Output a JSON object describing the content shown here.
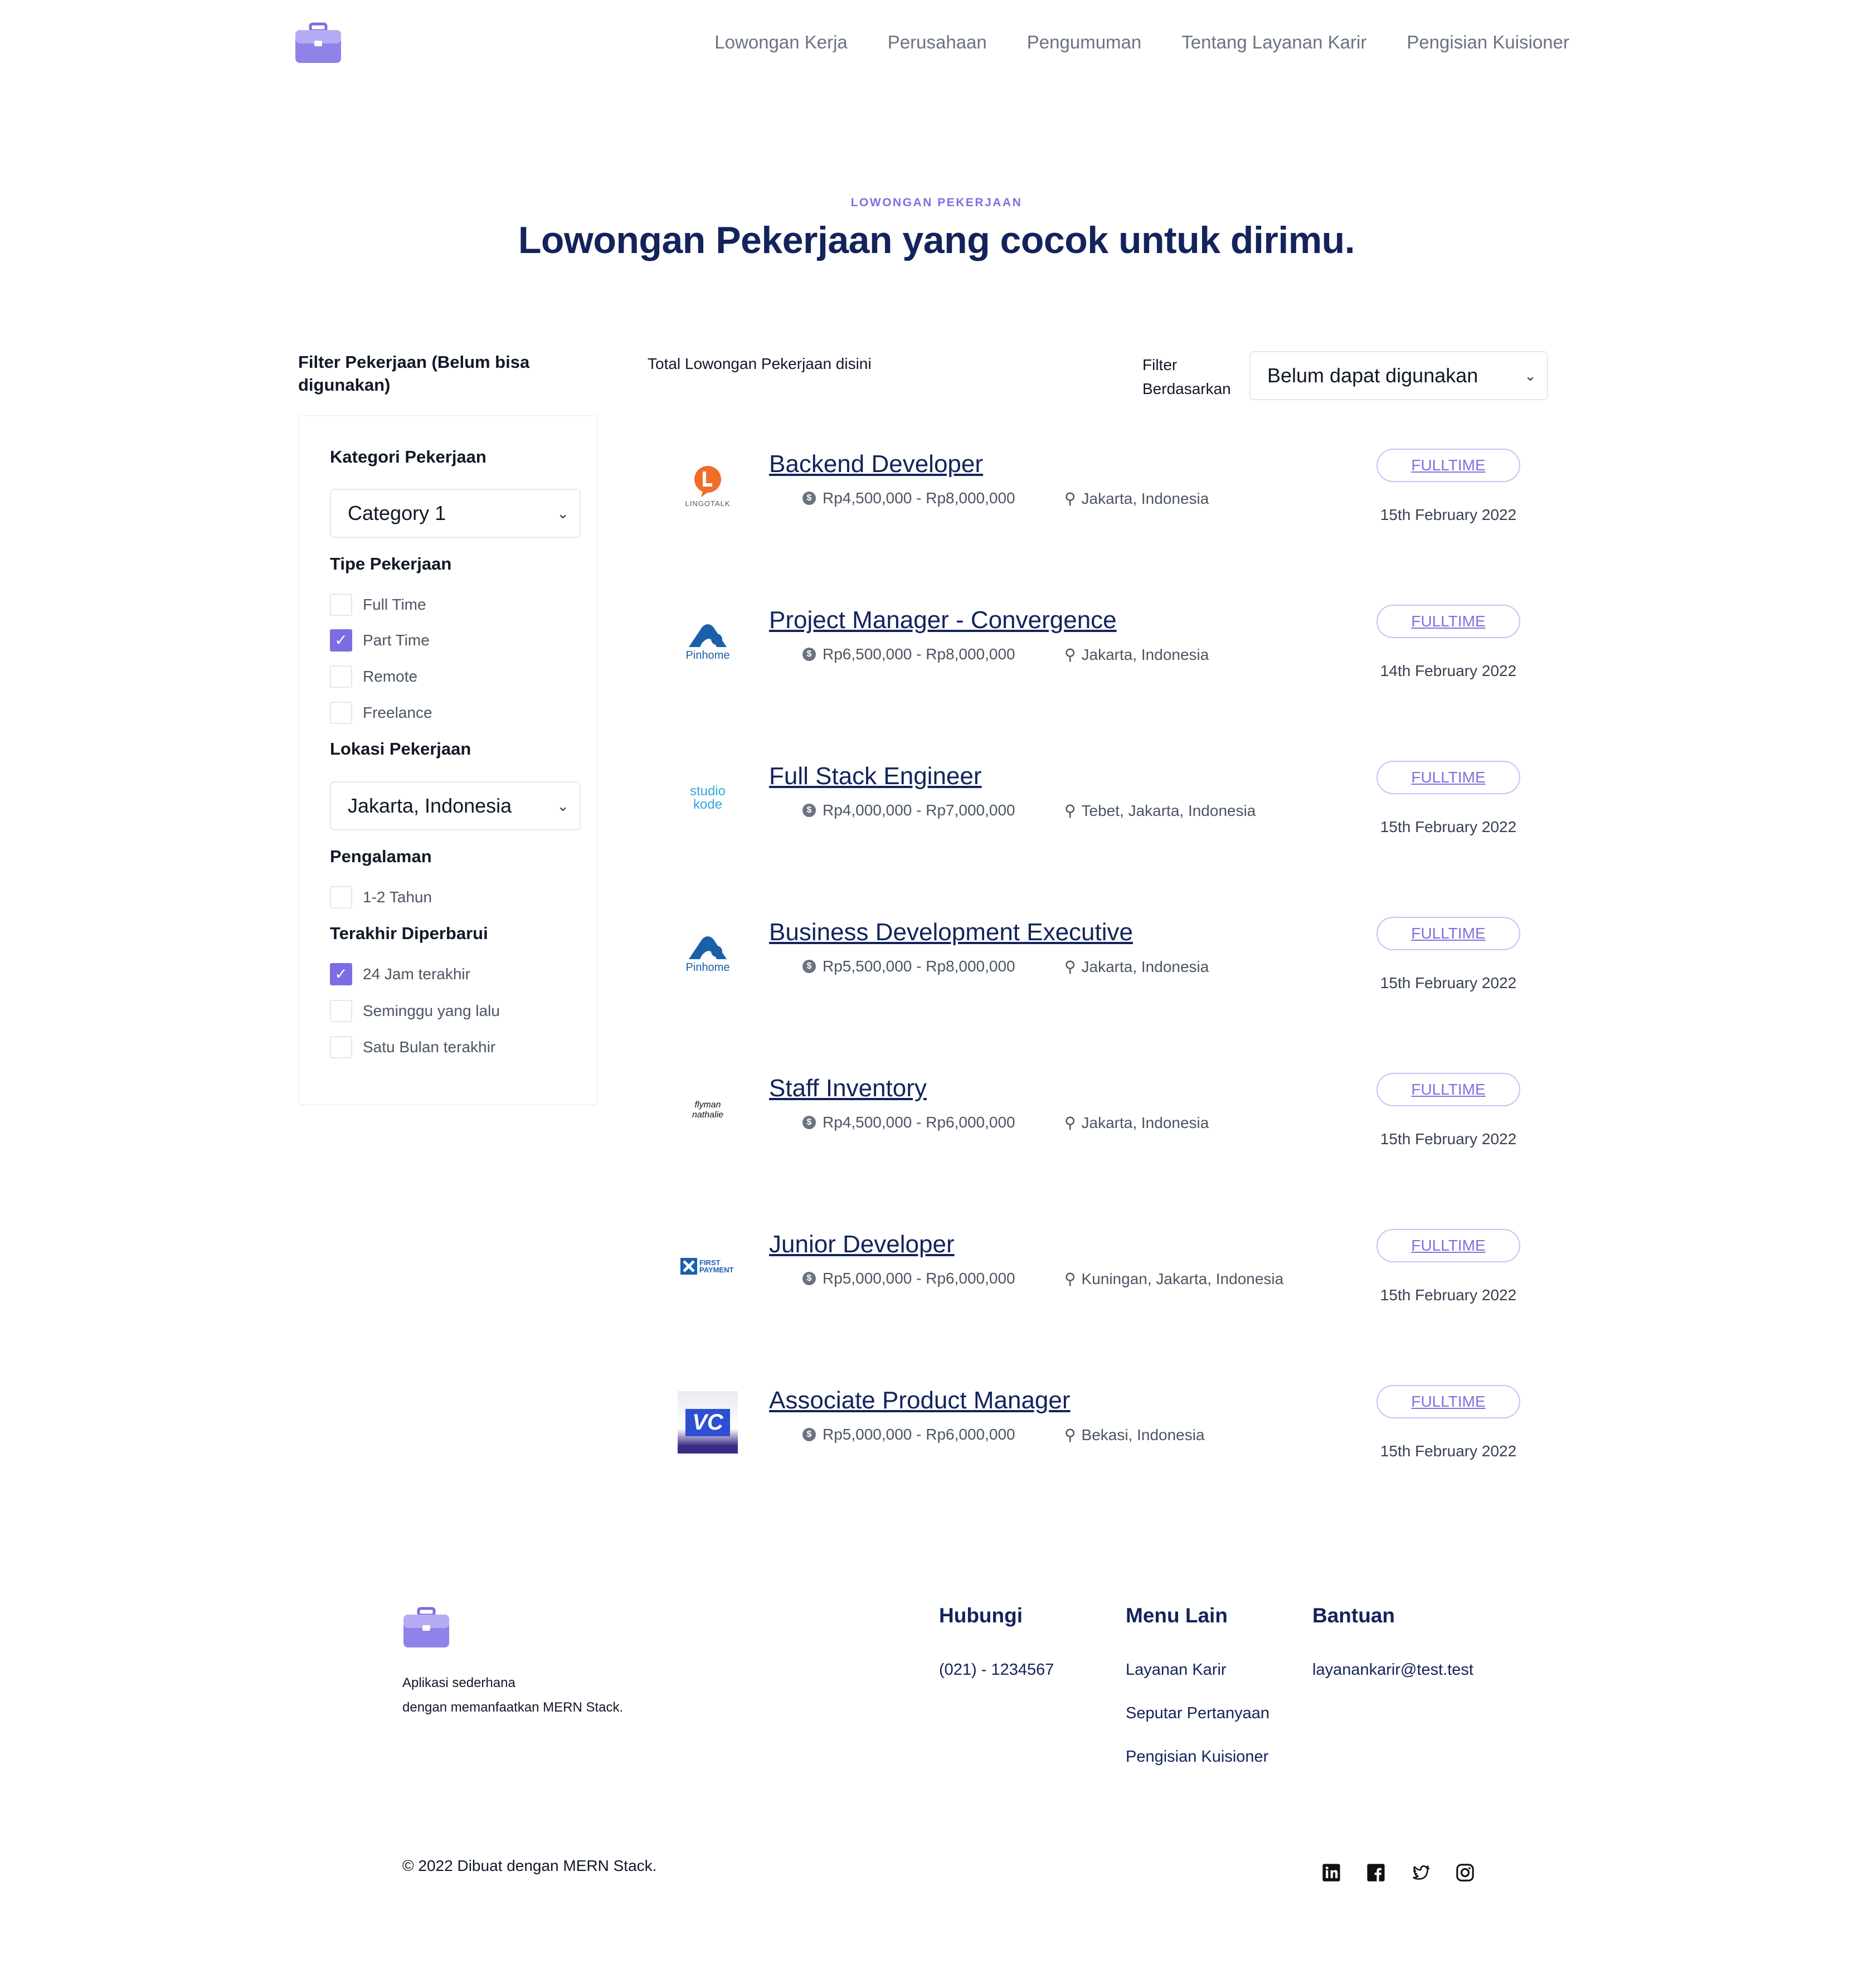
{
  "nav": {
    "items": [
      "Lowongan Kerja",
      "Perusahaan",
      "Pengumuman",
      "Tentang Layanan Karir",
      "Pengisian Kuisioner"
    ]
  },
  "hero": {
    "eyebrow": "LOWONGAN PEKERJAAN",
    "title": "Lowongan Pekerjaan yang cocok untuk dirimu."
  },
  "sidebar": {
    "title": "Filter Pekerjaan (Belum bisa digunakan)",
    "category": {
      "label": "Kategori Pekerjaan",
      "selected": "Category 1"
    },
    "job_type": {
      "label": "Tipe Pekerjaan",
      "options": [
        {
          "label": "Full Time",
          "checked": false
        },
        {
          "label": "Part Time",
          "checked": true
        },
        {
          "label": "Remote",
          "checked": false
        },
        {
          "label": "Freelance",
          "checked": false
        }
      ]
    },
    "location": {
      "label": "Lokasi Pekerjaan",
      "selected": "Jakarta, Indonesia"
    },
    "experience": {
      "label": "Pengalaman",
      "options": [
        {
          "label": "1-2 Tahun",
          "checked": false
        }
      ]
    },
    "updated": {
      "label": "Terakhir Diperbarui",
      "options": [
        {
          "label": "24 Jam terakhir",
          "checked": true
        },
        {
          "label": "Seminggu yang lalu",
          "checked": false
        },
        {
          "label": "Satu Bulan terakhir",
          "checked": false
        }
      ]
    }
  },
  "list": {
    "total_label": "Total Lowongan Pekerjaan disini",
    "filter_label": "Filter Berdasarkan",
    "filter_line1": "Filter",
    "filter_line2": "Berdasarkan",
    "sort_selected": "Belum dapat digunakan"
  },
  "jobs": [
    {
      "title": "Backend Developer",
      "salary": "Rp4,500,000 - Rp8,000,000",
      "location": "Jakarta, Indonesia",
      "type": "FULLTIME",
      "date": "15th February 2022",
      "logo_text": "LINGOTALK"
    },
    {
      "title": "Project Manager - Convergence",
      "salary": "Rp6,500,000 - Rp8,000,000",
      "location": "Jakarta, Indonesia",
      "type": "FULLTIME",
      "date": "14th February 2022",
      "logo_text": "Pinhome"
    },
    {
      "title": "Full Stack Engineer",
      "salary": "Rp4,000,000 - Rp7,000,000",
      "location": "Tebet, Jakarta, Indonesia",
      "type": "FULLTIME",
      "date": "15th February 2022",
      "logo_text": "studio kode"
    },
    {
      "title": "Business Development Executive",
      "salary": "Rp5,500,000 - Rp8,000,000",
      "location": "Jakarta, Indonesia",
      "type": "FULLTIME",
      "date": "15th February 2022",
      "logo_text": "Pinhome"
    },
    {
      "title": "Staff Inventory",
      "salary": "Rp4,500,000 - Rp6,000,000",
      "location": "Jakarta, Indonesia",
      "type": "FULLTIME",
      "date": "15th February 2022",
      "logo_text": "flyman nathalie"
    },
    {
      "title": "Junior Developer",
      "salary": "Rp5,000,000 - Rp6,000,000",
      "location": "Kuningan, Jakarta, Indonesia",
      "type": "FULLTIME",
      "date": "15th February 2022",
      "logo_text": "FIRST PAYMENT"
    },
    {
      "title": "Associate Product Manager",
      "salary": "Rp5,000,000 - Rp6,000,000",
      "location": "Bekasi, Indonesia",
      "type": "FULLTIME",
      "date": "15th February 2022",
      "logo_text": "VC"
    }
  ],
  "footer": {
    "desc_line1": "Aplikasi sederhana",
    "desc_line2": "dengan memanfaatkan MERN Stack.",
    "contact": {
      "heading": "Hubungi",
      "phone": "(021) - 1234567"
    },
    "menu": {
      "heading": "Menu Lain",
      "links": [
        "Layanan Karir",
        "Seputar Pertanyaan",
        "Pengisian Kuisioner"
      ]
    },
    "help": {
      "heading": "Bantuan",
      "email": "layanankarir@test.test"
    },
    "copyright": "© 2022 Dibuat dengan MERN Stack.",
    "social_icons": [
      "linkedin-icon",
      "facebook-icon",
      "twitter-icon",
      "instagram-icon"
    ]
  },
  "colors": {
    "primary": "#7c6de2",
    "navy": "#13235b",
    "gray": "#6b7280"
  }
}
